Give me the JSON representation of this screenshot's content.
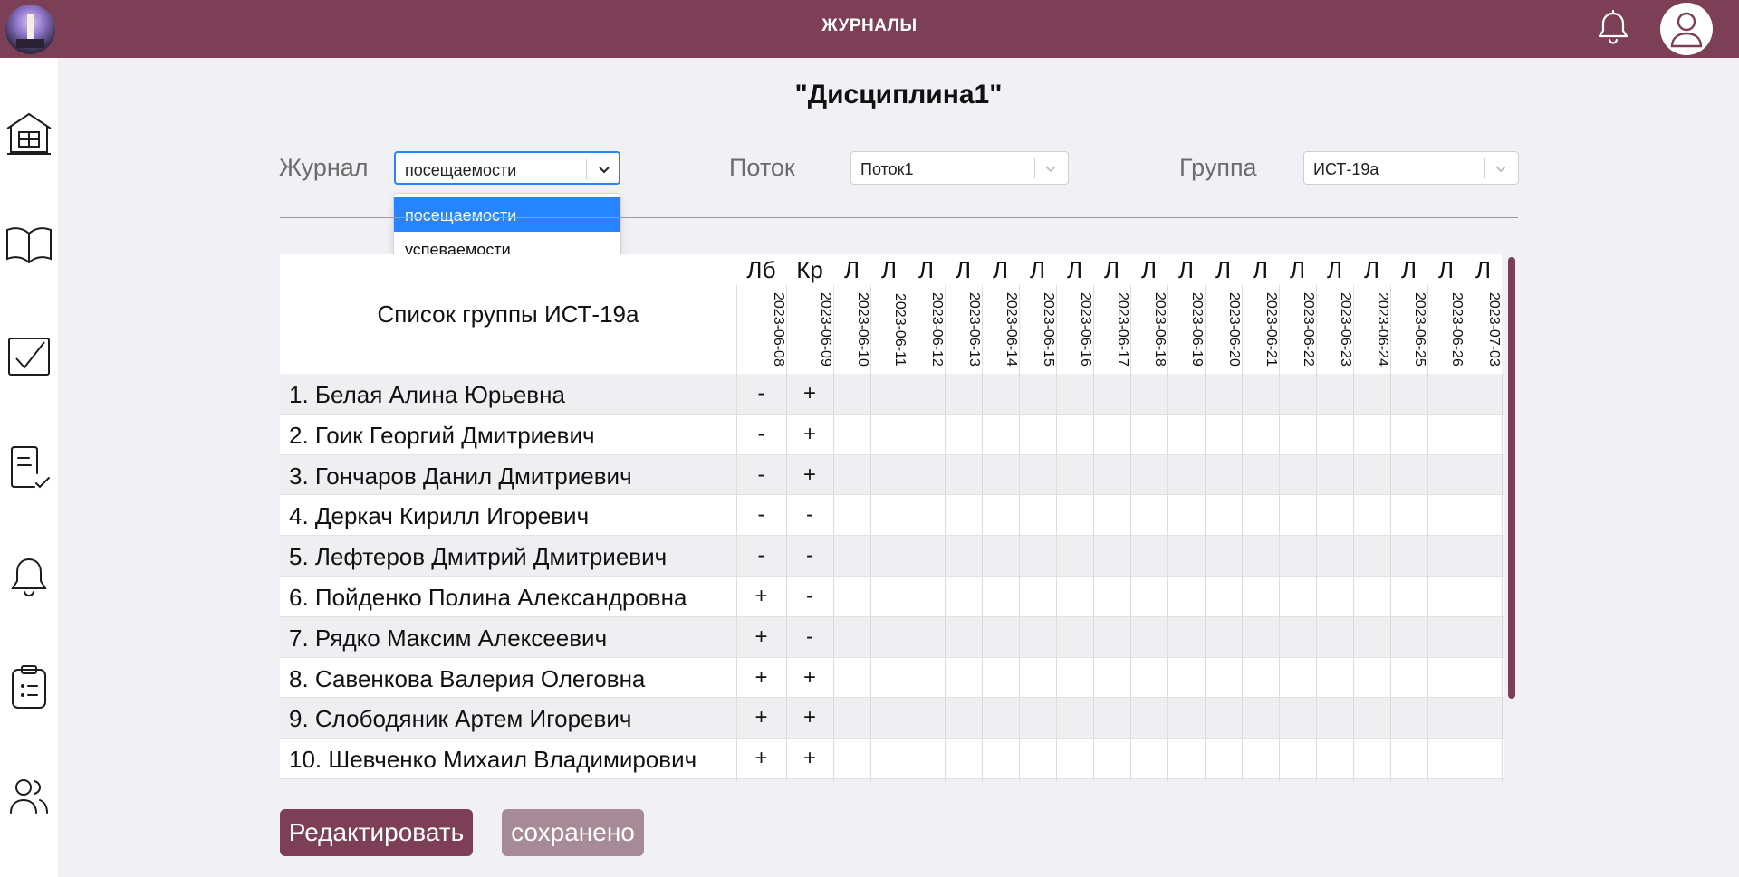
{
  "header": {
    "title": "ЖУРНАЛЫ"
  },
  "page": {
    "title": "\"Дисциплина1\""
  },
  "filters": {
    "journal_label": "Журнал",
    "journal_value": "посещаемости",
    "journal_options": [
      "посещаемости",
      "успеваемости"
    ],
    "stream_label": "Поток",
    "stream_value": "Поток1",
    "group_label": "Группа",
    "group_value": "ИСТ-19а"
  },
  "table": {
    "list_title": "Список группы ИСТ-19а",
    "columns": [
      {
        "type": "Лб",
        "date": "2023-06-08"
      },
      {
        "type": "Кр",
        "date": "2023-06-09"
      },
      {
        "type": "Л",
        "date": "2023-06-10"
      },
      {
        "type": "Л",
        "date": "2023-06-11"
      },
      {
        "type": "Л",
        "date": "2023-06-12"
      },
      {
        "type": "Л",
        "date": "2023-06-13"
      },
      {
        "type": "Л",
        "date": "2023-06-14"
      },
      {
        "type": "Л",
        "date": "2023-06-15"
      },
      {
        "type": "Л",
        "date": "2023-06-16"
      },
      {
        "type": "Л",
        "date": "2023-06-17"
      },
      {
        "type": "Л",
        "date": "2023-06-18"
      },
      {
        "type": "Л",
        "date": "2023-06-19"
      },
      {
        "type": "Л",
        "date": "2023-06-20"
      },
      {
        "type": "Л",
        "date": "2023-06-21"
      },
      {
        "type": "Л",
        "date": "2023-06-22"
      },
      {
        "type": "Л",
        "date": "2023-06-23"
      },
      {
        "type": "Л",
        "date": "2023-06-24"
      },
      {
        "type": "Л",
        "date": "2023-06-25"
      },
      {
        "type": "Л",
        "date": "2023-06-26"
      },
      {
        "type": "Л",
        "date": "2023-07-03"
      }
    ],
    "rows": [
      {
        "name": "1. Белая Алина Юрьевна",
        "marks": [
          "-",
          "+"
        ]
      },
      {
        "name": "2. Гоик Георгий Дмитриевич",
        "marks": [
          "-",
          "+"
        ]
      },
      {
        "name": "3. Гончаров Данил Дмитриевич",
        "marks": [
          "-",
          "+"
        ]
      },
      {
        "name": "4. Деркач Кирилл Игоревич",
        "marks": [
          "-",
          "-"
        ]
      },
      {
        "name": "5. Лефтеров Дмитрий Дмитриевич",
        "marks": [
          "-",
          "-"
        ]
      },
      {
        "name": "6. Пойденко Полина Александровна",
        "marks": [
          "+",
          "-"
        ]
      },
      {
        "name": "7. Рядко Максим Алексеевич",
        "marks": [
          "+",
          "-"
        ]
      },
      {
        "name": "8. Савенкова Валерия Олеговна",
        "marks": [
          "+",
          "+"
        ]
      },
      {
        "name": "9. Слободяник Артем Игоревич",
        "marks": [
          "+",
          "+"
        ]
      },
      {
        "name": "10. Шевченко Михаил Владимирович",
        "marks": [
          "+",
          "+"
        ]
      }
    ]
  },
  "buttons": {
    "edit": "Редактировать",
    "saved": "сохранено"
  },
  "colors": {
    "brand": "#7c3f55",
    "brand_light": "#a68a96",
    "select_focus": "#2684ff",
    "row_alt": "#efeff2"
  }
}
